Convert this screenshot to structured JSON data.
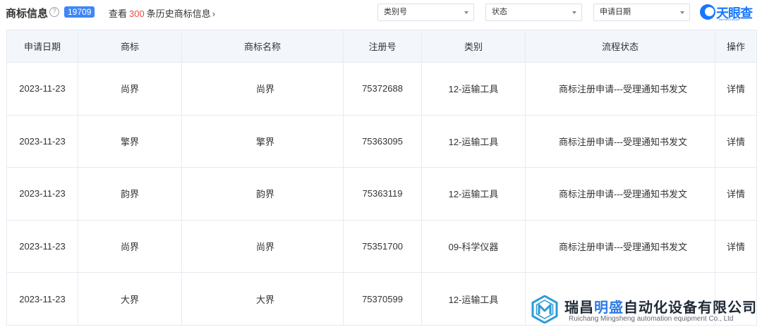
{
  "header": {
    "title": "商标信息",
    "help_icon": "?",
    "count": "19709",
    "history_prefix": "查看",
    "history_count": "300",
    "history_suffix": "条历史商标信息",
    "history_chevron": "›"
  },
  "filters": {
    "category": "类别号",
    "status": "状态",
    "date": "申请日期"
  },
  "brand": {
    "name": "天眼查",
    "sub": "TianYanCha.com"
  },
  "table": {
    "columns": [
      "申请日期",
      "商标",
      "商标名称",
      "注册号",
      "类别",
      "流程状态",
      "操作"
    ],
    "rows": [
      {
        "date": "2023-11-23",
        "mark": "尚界",
        "name": "尚界",
        "reg_no": "75372688",
        "category": "12-运输工具",
        "status": "商标注册申请---受理通知书发文",
        "action": "详情"
      },
      {
        "date": "2023-11-23",
        "mark": "擎界",
        "name": "擎界",
        "reg_no": "75363095",
        "category": "12-运输工具",
        "status": "商标注册申请---受理通知书发文",
        "action": "详情"
      },
      {
        "date": "2023-11-23",
        "mark": "韵界",
        "name": "韵界",
        "reg_no": "75363119",
        "category": "12-运输工具",
        "status": "商标注册申请---受理通知书发文",
        "action": "详情"
      },
      {
        "date": "2023-11-23",
        "mark": "尚界",
        "name": "尚界",
        "reg_no": "75351700",
        "category": "09-科学仪器",
        "status": "商标注册申请---受理通知书发文",
        "action": "详情"
      },
      {
        "date": "2023-11-23",
        "mark": "大界",
        "name": "大界",
        "reg_no": "75370599",
        "category": "12-运输工具",
        "status": "",
        "action": ""
      }
    ]
  },
  "watermark": {
    "name_part1": "瑞昌",
    "name_highlight": "明盛",
    "name_part2": "自动化设备有限公司",
    "english": "Ruichang Mingsheng automation equipment Co., Ltd"
  },
  "colors": {
    "accent": "#3f86f7",
    "highlight_number": "#f04a4a",
    "header_bg": "#f3f7fc",
    "brand_blue": "#1677ff"
  }
}
